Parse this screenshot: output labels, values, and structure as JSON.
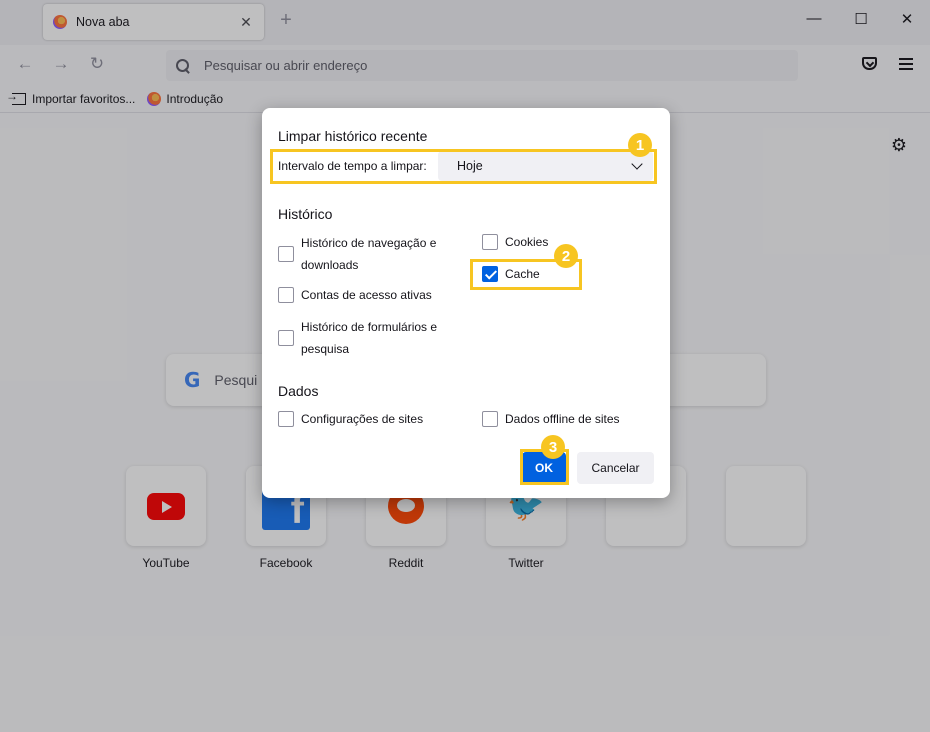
{
  "tab": {
    "title": "Nova aba",
    "close": "✕",
    "new": "+"
  },
  "window": {
    "minimize": "—",
    "maximize": "☐",
    "close": "✕"
  },
  "nav": {
    "back": "←",
    "forward": "→",
    "reload": "↻",
    "url_placeholder": "Pesquisar ou abrir endereço"
  },
  "bookmarks": [
    {
      "label": "Importar favoritos..."
    },
    {
      "label": "Introdução"
    }
  ],
  "newtab": {
    "settings": "⚙",
    "search_placeholder": "Pesqui",
    "google": "G",
    "tiles": [
      {
        "label": "YouTube"
      },
      {
        "label": "Facebook",
        "glyph": "f"
      },
      {
        "label": "Reddit"
      },
      {
        "label": "Twitter",
        "glyph": "🐦"
      },
      {
        "label": ""
      },
      {
        "label": ""
      }
    ]
  },
  "dialog": {
    "title": "Limpar histórico recente",
    "range_label": "Intervalo de tempo a limpar:",
    "range_value": "Hoje",
    "history_title": "Histórico",
    "data_title": "Dados",
    "options": {
      "nav_history": {
        "label": "Histórico de navegação e downloads",
        "checked": false
      },
      "cookies": {
        "label": "Cookies",
        "checked": false
      },
      "cache": {
        "label": "Cache",
        "checked": true
      },
      "logins": {
        "label": "Contas de acesso ativas",
        "checked": false
      },
      "forms": {
        "label": "Histórico de formulários e pesquisa",
        "checked": false
      },
      "site_settings": {
        "label": "Configurações de sites",
        "checked": false
      },
      "offline": {
        "label": "Dados offline de sites",
        "checked": false
      }
    },
    "ok": "OK",
    "cancel": "Cancelar"
  },
  "annotations": {
    "badge1": "1",
    "badge2": "2",
    "badge3": "3",
    "color": "#f7c521"
  }
}
